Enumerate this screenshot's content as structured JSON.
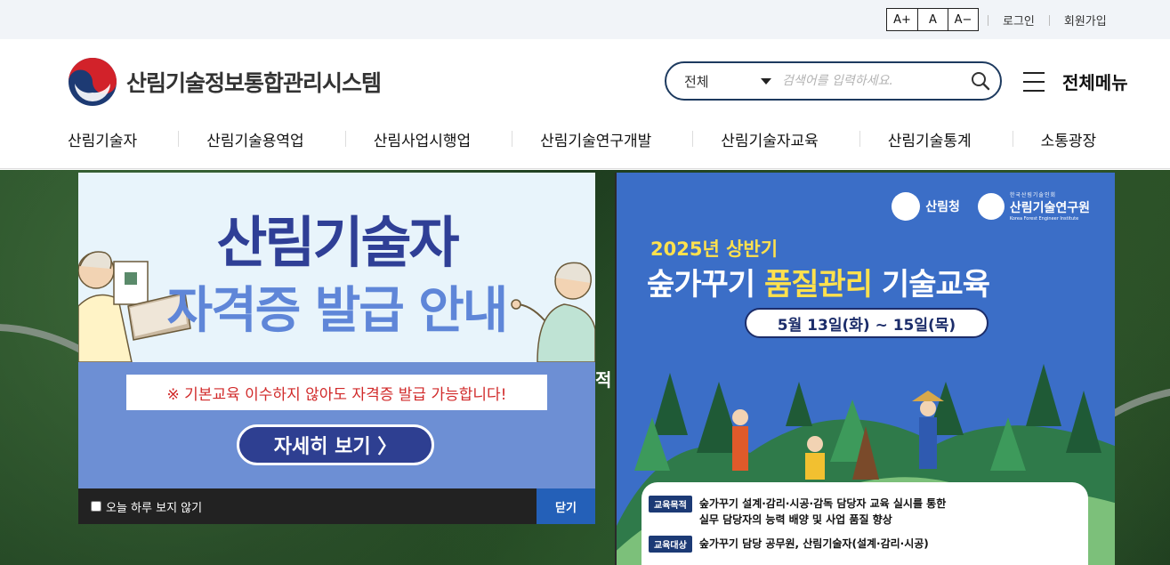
{
  "colors": {
    "brand_navy": "#1d3a5f",
    "topbar_bg": "#f1f4f8",
    "popup1_title": "#2f3f96",
    "popup1_subtitle": "#5f86d8",
    "popup1_notice_red": "#d12a2a",
    "close_button_blue": "#2460b8",
    "popup2_bg": "#3b6ec7",
    "popup2_highlight": "#ffe14d"
  },
  "topbar": {
    "font_size_controls": [
      "A+",
      "A",
      "A−"
    ],
    "login": "로그인",
    "signup": "회원가입"
  },
  "header": {
    "site_title": "산림기술정보통합관리시스템",
    "logo_icon": "taegeuk-logo-icon",
    "search": {
      "category": "전체",
      "placeholder": "검색어를 입력하세요.",
      "icon": "search-icon"
    },
    "all_menu_label": "전체메뉴",
    "all_menu_icon": "hamburger-icon"
  },
  "gnb": {
    "items": [
      "산림기술자",
      "산림기술용역업",
      "산림사업시행업",
      "산림기술연구개발",
      "산림기술자교육",
      "산림기술통계",
      "소통광장"
    ]
  },
  "hero": {
    "peek_text": "적"
  },
  "popup1": {
    "title_line1": "산림기술자",
    "title_line2": "자격증 발급 안내",
    "notice": "※ 기본교육 이수하지 않아도 자격증 발급 가능합니다!",
    "detail_button": "자세히 보기 〉",
    "dont_show_today": "오늘 하루 보지 않기",
    "close": "닫기"
  },
  "popup2": {
    "org1": "산림청",
    "org2_small": "한국산림기술인회",
    "org2_name": "산림기술연구원",
    "org2_en": "Korea Forest Engineer Institute",
    "year_label": "2025년 상반기",
    "title_part1": "숲가꾸기 ",
    "title_highlight": "품질관리",
    "title_part2": " 기술교육",
    "date_range": "5월 13일(화) ~ 15일(목)",
    "rows": [
      {
        "tag": "교육목적",
        "text_line1": "숲가꾸기 설계·감리·시공·감독 담당자 교육 실시를 통한",
        "text_line2": "실무 담당자의 능력 배양 및 사업 품질 향상"
      },
      {
        "tag": "교육대상",
        "text_line1": "숲가꾸기 담당 공무원, 산림기술자(설계·감리·시공)",
        "text_line2": ""
      }
    ]
  }
}
